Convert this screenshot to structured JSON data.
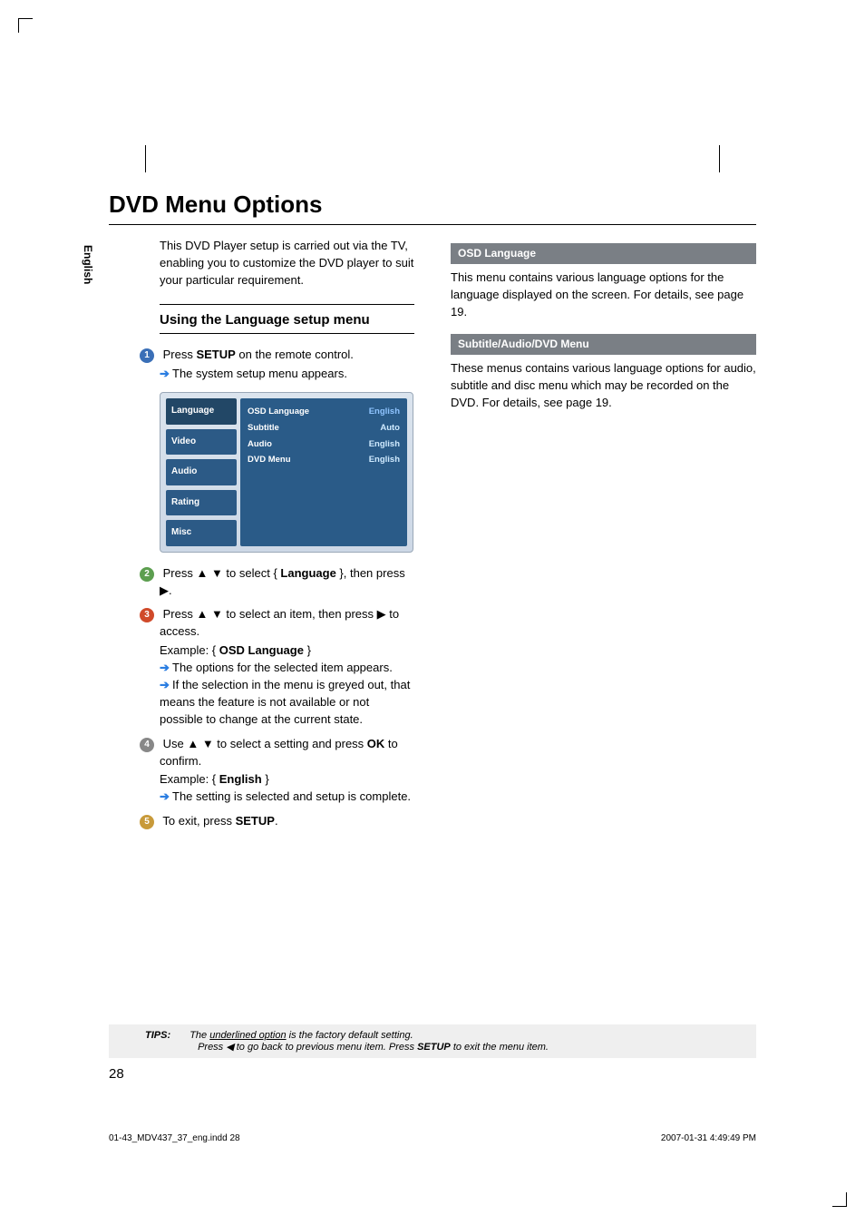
{
  "title": "DVD Menu Options",
  "lang_tab": "English",
  "intro": "This DVD Player setup is carried out via the TV, enabling you to customize the DVD player to suit your particular requirement.",
  "section_heading": "Using the Language setup menu",
  "steps": {
    "s1a": "Press ",
    "s1b": "SETUP",
    "s1c": " on the remote control.",
    "s1_bullet": "The system setup menu appears.",
    "s2a": "Press ▲ ▼ to select { ",
    "s2b": "Language",
    "s2c": " }, then press ▶.",
    "s3a": "Press ▲ ▼ to select an item, then press ▶ to access.",
    "s3_example_a": "Example: { ",
    "s3_example_b": "OSD Language",
    "s3_example_c": " }",
    "s3_bullet1": "The options for the selected item appears.",
    "s3_bullet2": "If the selection in the menu is greyed out, that means the feature is not available or not possible to change at the current state.",
    "s4a": "Use ▲ ▼ to select a setting and press ",
    "s4b": "OK",
    "s4c": " to confirm.",
    "s4_example_a": "Example: { ",
    "s4_example_b": "English",
    "s4_example_c": " }",
    "s4_bullet": "The setting is selected and setup is complete.",
    "s5a": "To exit, press ",
    "s5b": "SETUP",
    "s5c": "."
  },
  "osd_tabs": [
    "Language",
    "Video",
    "Audio",
    "Rating",
    "Misc"
  ],
  "osd_rows": [
    {
      "k": "OSD Language",
      "v": "English"
    },
    {
      "k": "Subtitle",
      "v": "Auto"
    },
    {
      "k": "Audio",
      "v": "English"
    },
    {
      "k": "DVD Menu",
      "v": "English"
    }
  ],
  "right": {
    "bar1": "OSD Language",
    "p1": "This menu contains various language options for the language displayed on the screen. For details, see page 19.",
    "bar2": "Subtitle/Audio/DVD Menu",
    "p2": "These menus contains various language options for audio, subtitle and disc menu which may be recorded on the DVD. For details, see page 19."
  },
  "tips": {
    "label": "TIPS:",
    "line1a": "The ",
    "line1b": "underlined option",
    "line1c": " is the factory default setting.",
    "line2a": "Press ◀ to go back to previous menu item. Press ",
    "line2b": "SETUP",
    "line2c": " to exit the menu item."
  },
  "page_number": "28",
  "footer_left": "01-43_MDV437_37_eng.indd   28",
  "footer_right": "2007-01-31   4:49:49 PM"
}
